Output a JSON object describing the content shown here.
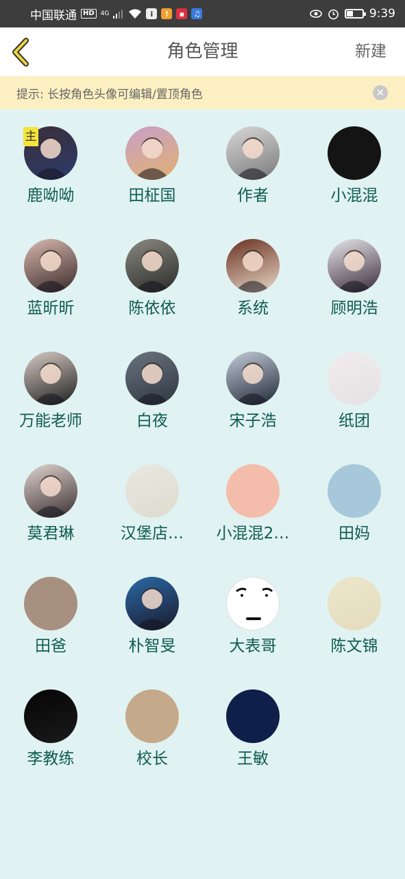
{
  "status_bar": {
    "carrier": "中国联通",
    "hd": "HD",
    "network": "4G",
    "time": "9:39",
    "battery_level": 0.4
  },
  "nav": {
    "title": "角色管理",
    "new_label": "新建"
  },
  "tip": {
    "text": "提示: 长按角色头像可编辑/置顶角色",
    "close_glyph": "✕"
  },
  "characters": [
    {
      "name": "鹿呦呦",
      "badge": "主",
      "avatar": "photo-girl-dark-icon",
      "colors": [
        "#3a2f3a",
        "#2c3a6a"
      ]
    },
    {
      "name": "田柾国",
      "avatar": "photo-boy-pink-hair-icon",
      "colors": [
        "#c8a0c8",
        "#e0b070"
      ]
    },
    {
      "name": "作者",
      "avatar": "photo-boy-gray-icon",
      "colors": [
        "#d8d8d8",
        "#7a7a7a"
      ]
    },
    {
      "name": "小混混",
      "avatar": "black-avatar-icon",
      "colors": [
        "#141414",
        "#141414"
      ]
    },
    {
      "name": "蓝昕昕",
      "avatar": "photo-girl-bangs-icon",
      "colors": [
        "#d9b8b0",
        "#3a2a28"
      ]
    },
    {
      "name": "陈依依",
      "avatar": "photo-girl-street-icon",
      "colors": [
        "#8a8a80",
        "#2a2a2a"
      ]
    },
    {
      "name": "系统",
      "avatar": "anime-girl-icon",
      "colors": [
        "#6a3020",
        "#e8d8c8"
      ]
    },
    {
      "name": "顾明浩",
      "avatar": "photo-boy-white-icon",
      "colors": [
        "#e8e8ea",
        "#3a2a3a"
      ]
    },
    {
      "name": "万能老师",
      "avatar": "photo-woman-black-icon",
      "colors": [
        "#d8ccc4",
        "#1e1e1e"
      ]
    },
    {
      "name": "白夜",
      "avatar": "photo-boy-sitting-icon",
      "colors": [
        "#6a7480",
        "#2e3640"
      ]
    },
    {
      "name": "宋子浩",
      "avatar": "photo-boy-lattice-icon",
      "colors": [
        "#c4ccd8",
        "#202838"
      ]
    },
    {
      "name": "纸团",
      "avatar": "paper-texture-icon",
      "colors": [
        "#f0eced",
        "#e6e2e4"
      ]
    },
    {
      "name": "莫君琳",
      "avatar": "photo-girl-hands-icon",
      "colors": [
        "#e0d4d0",
        "#3a3030"
      ]
    },
    {
      "name": "汉堡店…",
      "avatar": "plain-light-icon",
      "colors": [
        "#e8e8e0",
        "#dcdcd0"
      ]
    },
    {
      "name": "小混混2…",
      "avatar": "plain-peach-icon",
      "colors": [
        "#f4bcaa",
        "#f4bcaa"
      ]
    },
    {
      "name": "田妈",
      "avatar": "plain-blue-icon",
      "colors": [
        "#a6c8da",
        "#a6c8da"
      ]
    },
    {
      "name": "田爸",
      "avatar": "plain-taupe-icon",
      "colors": [
        "#a89080",
        "#a89080"
      ]
    },
    {
      "name": "朴智旻",
      "avatar": "photo-boy-suit-icon",
      "colors": [
        "#2a6aa8",
        "#1a1a2a"
      ]
    },
    {
      "name": "大表哥",
      "avatar": "meme-face-icon",
      "colors": [
        "#ffffff",
        "#ffffff"
      ]
    },
    {
      "name": "陈文锦",
      "avatar": "plain-cream-icon",
      "colors": [
        "#ece6cc",
        "#e4dcbc"
      ]
    },
    {
      "name": "李教练",
      "avatar": "plain-black-icon",
      "colors": [
        "#050505",
        "#1a1a1a"
      ]
    },
    {
      "name": "校长",
      "avatar": "plain-tan-icon",
      "colors": [
        "#c4aa8a",
        "#c4aa8a"
      ]
    },
    {
      "name": "王敏",
      "avatar": "plain-navy-icon",
      "colors": [
        "#0e1f4a",
        "#0e1f4a"
      ]
    }
  ]
}
